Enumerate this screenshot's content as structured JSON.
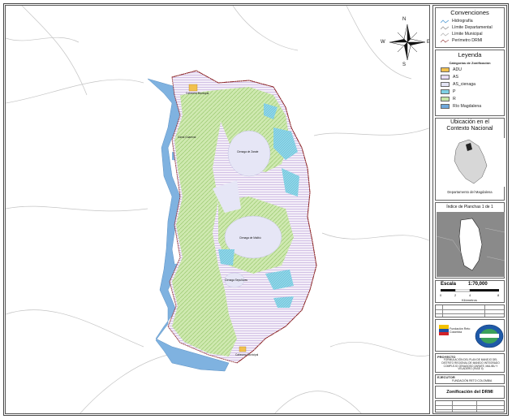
{
  "map": {
    "north_arrow": {
      "n": "N",
      "s": "S",
      "e": "E",
      "w": "W"
    },
    "place_labels": [
      "Cabecera Municipal",
      "Canal Guarenal",
      "Cienaga de Zarate",
      "Cienaga de Malibú",
      "Cienaga Sepulturas",
      "Cabecera Municipal"
    ]
  },
  "legend_panel": {
    "conventions_title": "Convenciones",
    "conventions": [
      {
        "label": "Hidrografía",
        "color": "#5aa0d6"
      },
      {
        "label": "Límite Departamental",
        "color": "#9a9a9a"
      },
      {
        "label": "Límite Municipal",
        "color": "#b8b8b8"
      },
      {
        "label": "Perímetro DRMI",
        "color": "#8a2020"
      }
    ],
    "legend_title": "Leyenda",
    "categories_title": "Categorías de Zonificación",
    "categories": [
      {
        "label": "ADU",
        "color": "#f2c14e"
      },
      {
        "label": "AS",
        "color": "#d9c9ec"
      },
      {
        "label": "AS_cienaga",
        "color": "#e4e5f5"
      },
      {
        "label": "P",
        "color": "#7fd0e4"
      },
      {
        "label": "R",
        "color": "#c6e5a6"
      },
      {
        "label": "Río Magdalena",
        "color": "#6fa8dc"
      }
    ],
    "location_title": "Ubicación en el Contexto Nacional",
    "department_label": "Departamento del Magdalena",
    "index_label": "Índice de Planchas 1 de 1",
    "scale_title": "Escala",
    "scale_value": "1:70,000",
    "scale_ticks": [
      "0",
      "2",
      "4",
      "8"
    ],
    "scale_unit": "Kilómetros",
    "project_label": "PROYECTO",
    "project_text": "FORMULACIÓN DEL PLAN DE MANEJO DEL DISTRITO REGIONAL DE MANEJO INTEGRADO COMPLEJO CENAGOSO ZARATE, MALIBU Y VELADERO (FASE II)",
    "executor_label": "EJECUTOR",
    "executor_text": "FUNDACIÓN RETO COLOMBIA",
    "plate_title": "Zonificación del DRMI",
    "logo_text": "Fundación Reto Colombia"
  }
}
